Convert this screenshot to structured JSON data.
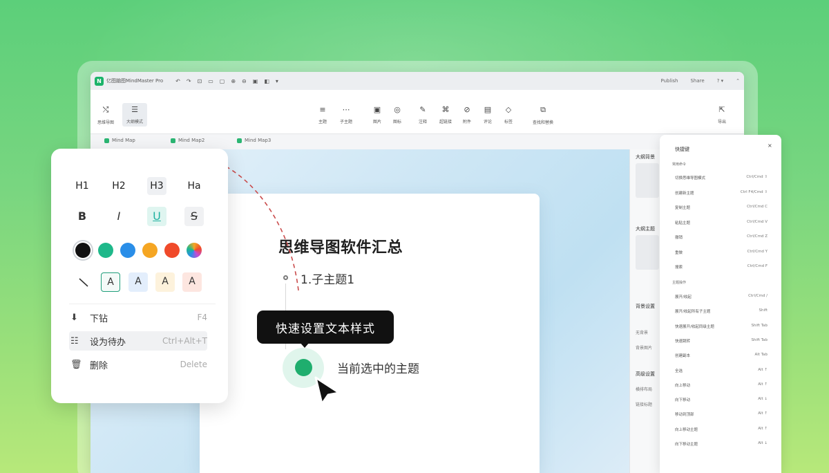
{
  "app": {
    "logo": "N",
    "title": "亿图脑图MindMaster Pro",
    "titlebar_icons": [
      "↶",
      "↷",
      "⊡",
      "▭",
      "▢",
      "⊕",
      "⊖",
      "▣",
      "◧",
      "▾"
    ],
    "publish_label": "Publish",
    "share_label": "Share",
    "help_label": "? ▾",
    "collapse_label": "⌃"
  },
  "toolbar": {
    "tools": [
      {
        "icon": "⤭",
        "label": "思维导图"
      },
      {
        "icon": "☰",
        "label": "大纲模式"
      },
      {
        "icon": "≡",
        "label": "主题"
      },
      {
        "icon": "⋯",
        "label": "子主题"
      },
      {
        "icon": "▣",
        "label": "图片"
      },
      {
        "icon": "◎",
        "label": "图标"
      },
      {
        "icon": "✎",
        "label": "注释"
      },
      {
        "icon": "⌘",
        "label": "超链接"
      },
      {
        "icon": "⊘",
        "label": "附件"
      },
      {
        "icon": "▤",
        "label": "评论"
      },
      {
        "icon": "◇",
        "label": "标签"
      },
      {
        "icon": "⧉",
        "label": "查找和替换"
      },
      {
        "icon": "⇱",
        "label": "导出"
      }
    ]
  },
  "tabs": [
    "Mind Map",
    "Mind Map2",
    "Mind Map3"
  ],
  "right_panel": {
    "labels": [
      "大纲背景",
      "大纲主题",
      "背景设置",
      "无背景",
      "背景图片",
      "高级设置",
      "横排布局",
      "链接标题"
    ]
  },
  "document": {
    "title": "思维导图软件汇总",
    "sub_topic": "1.子主题1",
    "selected_topic": "当前选中的主题"
  },
  "tooltip": {
    "text": "快速设置文本样式"
  },
  "style_popup": {
    "headings": [
      "H1",
      "H2",
      "H3",
      "Ha"
    ],
    "format": {
      "bold": "B",
      "italic": "I",
      "underline": "U",
      "strike": "S"
    },
    "colors": [
      "#111111",
      "#1fb88a",
      "#2a8ee8",
      "#f5a623",
      "#f04a2a",
      "rainbow"
    ],
    "text_box_letter": "A",
    "menu": [
      {
        "icon": "⬇",
        "label": "下钻",
        "shortcut": "F4"
      },
      {
        "icon": "☷",
        "label": "设为待办",
        "shortcut": "Ctrl+Alt+T"
      },
      {
        "icon": "🗑",
        "label": "删除",
        "shortcut": "Delete"
      }
    ]
  },
  "shortcut_panel": {
    "title": "快捷键",
    "close": "×",
    "sections": [
      "常用命令",
      "主题操作"
    ],
    "rows": [
      {
        "label": "切换思维导图模式",
        "key": "Ctrl/Cmd  ⇧"
      },
      {
        "label": "创建新主题",
        "key": "Ctrl  F4/Cmd  ⇧"
      },
      {
        "label": "复制主题",
        "key": "Ctrl/Cmd  C"
      },
      {
        "label": "粘贴主题",
        "key": "Ctrl/Cmd  V"
      },
      {
        "label": "撤销",
        "key": "Ctrl/Cmd  Z"
      },
      {
        "label": "重做",
        "key": "Ctrl/Cmd  Y"
      },
      {
        "label": "搜索",
        "key": "Ctrl/Cmd  F"
      },
      {
        "label": "展开/收起",
        "key": "Ctrl/Cmd  /"
      },
      {
        "label": "展开/收起所有子主题",
        "key": "Shift"
      },
      {
        "label": "快速展开/收起同级主题",
        "key": "Shift  Tab"
      },
      {
        "label": "快速跳转",
        "key": "Shift  Tab"
      },
      {
        "label": "创建副本",
        "key": "Alt  Tab"
      },
      {
        "label": "全选",
        "key": "Alt  ↑"
      },
      {
        "label": "向上移动",
        "key": "Alt  ↑"
      },
      {
        "label": "向下移动",
        "key": "Alt  ↓"
      },
      {
        "label": "移动到顶部",
        "key": "Alt  ↑"
      },
      {
        "label": "向上移动主题",
        "key": "Alt  ↑"
      },
      {
        "label": "向下移动主题",
        "key": "Alt  ↓"
      }
    ]
  }
}
